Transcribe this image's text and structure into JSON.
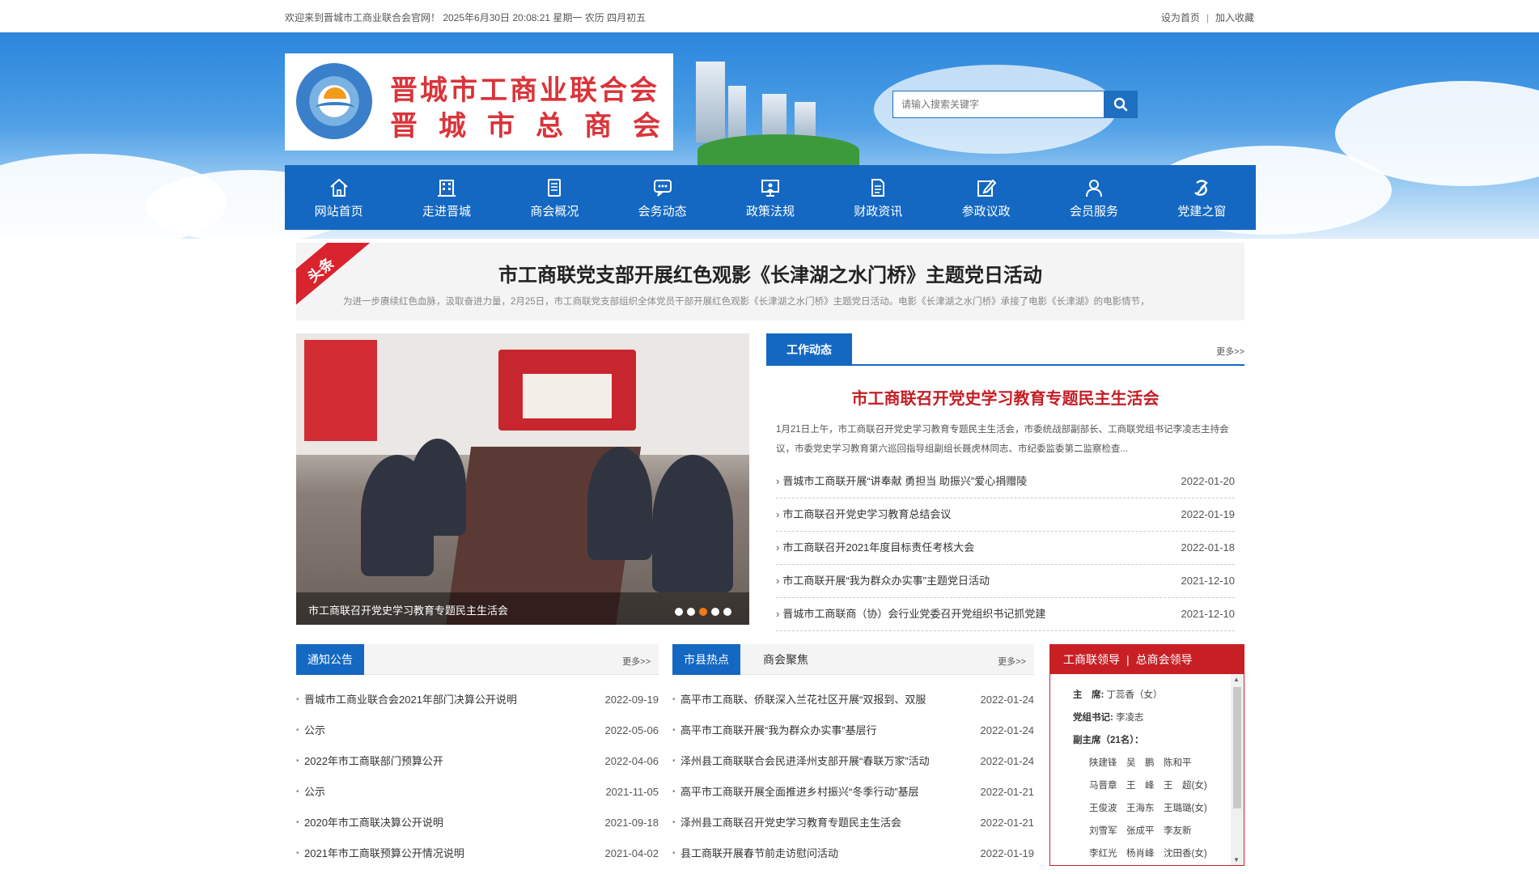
{
  "topbar": {
    "welcome": "欢迎来到晋城市工商业联合会官网！ 2025年6月30日 20:08:21 星期一 农历 四月初五",
    "set_home": "设为首页",
    "separator": "|",
    "add_fav": "加入收藏"
  },
  "logo": {
    "line1": "晋城市工商业联合会",
    "line2": "晋城市总商会"
  },
  "search": {
    "placeholder": "请输入搜索关键字"
  },
  "nav": [
    {
      "label": "网站首页",
      "icon": "home-icon"
    },
    {
      "label": "走进晋城",
      "icon": "building-icon"
    },
    {
      "label": "商会概况",
      "icon": "document-icon"
    },
    {
      "label": "会务动态",
      "icon": "chat-icon"
    },
    {
      "label": "政策法规",
      "icon": "presentation-icon"
    },
    {
      "label": "财政资讯",
      "icon": "file-icon"
    },
    {
      "label": "参政议政",
      "icon": "edit-icon"
    },
    {
      "label": "会员服务",
      "icon": "user-icon"
    },
    {
      "label": "党建之窗",
      "icon": "party-emblem-icon"
    }
  ],
  "headline": {
    "badge": "头条",
    "title": "市工商联党支部开展红色观影《长津湖之水门桥》主题党日活动",
    "summary": "为进一步赓续红色血脉，汲取奋进力量，2月25日，市工商联党支部组织全体党员干部开展红色观影《长津湖之水门桥》主题党日活动。电影《长津湖之水门桥》承接了电影《长津湖》的电影情节，"
  },
  "slider": {
    "caption": "市工商联召开党史学习教育专题民主生活会",
    "dots": 5,
    "active_dot": 3
  },
  "work": {
    "tab": "工作动态",
    "more": "更多>>",
    "feature_title": "市工商联召开党史学习教育专题民主生活会",
    "feature_summary": "1月21日上午，市工商联召开党史学习教育专题民主生活会，市委统战部副部长、工商联党组书记李凌志主持会议，市委党史学习教育第六巡回指导组副组长聂虎林同志、市纪委监委第二监察检查...",
    "items": [
      {
        "title": "晋城市工商联开展“讲奉献 勇担当 助振兴”爱心捐赠陵",
        "date": "2022-01-20"
      },
      {
        "title": "市工商联召开党史学习教育总结会议",
        "date": "2022-01-19"
      },
      {
        "title": "市工商联召开2021年度目标责任考核大会",
        "date": "2022-01-18"
      },
      {
        "title": "市工商联开展“我为群众办实事”主题党日活动",
        "date": "2021-12-10"
      },
      {
        "title": "晋城市工商联商（协）会行业党委召开党组织书记抓党建",
        "date": "2021-12-10"
      }
    ]
  },
  "notice": {
    "tab": "通知公告",
    "more": "更多>>",
    "items": [
      {
        "title": "晋城市工商业联合会2021年部门决算公开说明",
        "date": "2022-09-19"
      },
      {
        "title": "公示",
        "date": "2022-05-06"
      },
      {
        "title": "2022年市工商联部门预算公开",
        "date": "2022-04-06"
      },
      {
        "title": "公示",
        "date": "2021-11-05"
      },
      {
        "title": "2020年市工商联决算公开说明",
        "date": "2021-09-18"
      },
      {
        "title": "2021年市工商联预算公开情况说明",
        "date": "2021-04-02"
      }
    ]
  },
  "hotspot": {
    "tab": "市县热点",
    "tab2": "商会聚焦",
    "more": "更多>>",
    "items": [
      {
        "title": "高平市工商联、侨联深入兰花社区开展“双报到、双服",
        "date": "2022-01-24"
      },
      {
        "title": "高平市工商联开展“我为群众办实事”基层行",
        "date": "2022-01-24"
      },
      {
        "title": "泽州县工商联联合会民进泽州支部开展“春联万家”活动",
        "date": "2022-01-24"
      },
      {
        "title": "高平市工商联开展全面推进乡村振兴“冬季行动”基层",
        "date": "2022-01-21"
      },
      {
        "title": "泽州县工商联召开党史学习教育专题民主生活会",
        "date": "2022-01-21"
      },
      {
        "title": "县工商联开展春节前走访慰问活动",
        "date": "2022-01-19"
      }
    ]
  },
  "leaders": {
    "tab1": "工商联领导",
    "sep": "|",
    "tab2": "总商会领导",
    "chair_label": "主　席:",
    "chair": "丁蕊香（女）",
    "secretary_label": "党组书记:",
    "secretary": "李凌志",
    "vice_label": "副主席（21名）：",
    "vice_rows": [
      "陕建锋　吴　鹏　陈和平",
      "马晋章　王　峰　王　超(女)",
      "王俊波　王海东　王璐璐(女)",
      "刘雪军　张成平　李友新",
      "李红光　杨肖峰　沈田香(女)"
    ]
  },
  "colors": {
    "primary": "#1468c2",
    "accent_red": "#c81f25",
    "headline_red": "#d9232d"
  }
}
